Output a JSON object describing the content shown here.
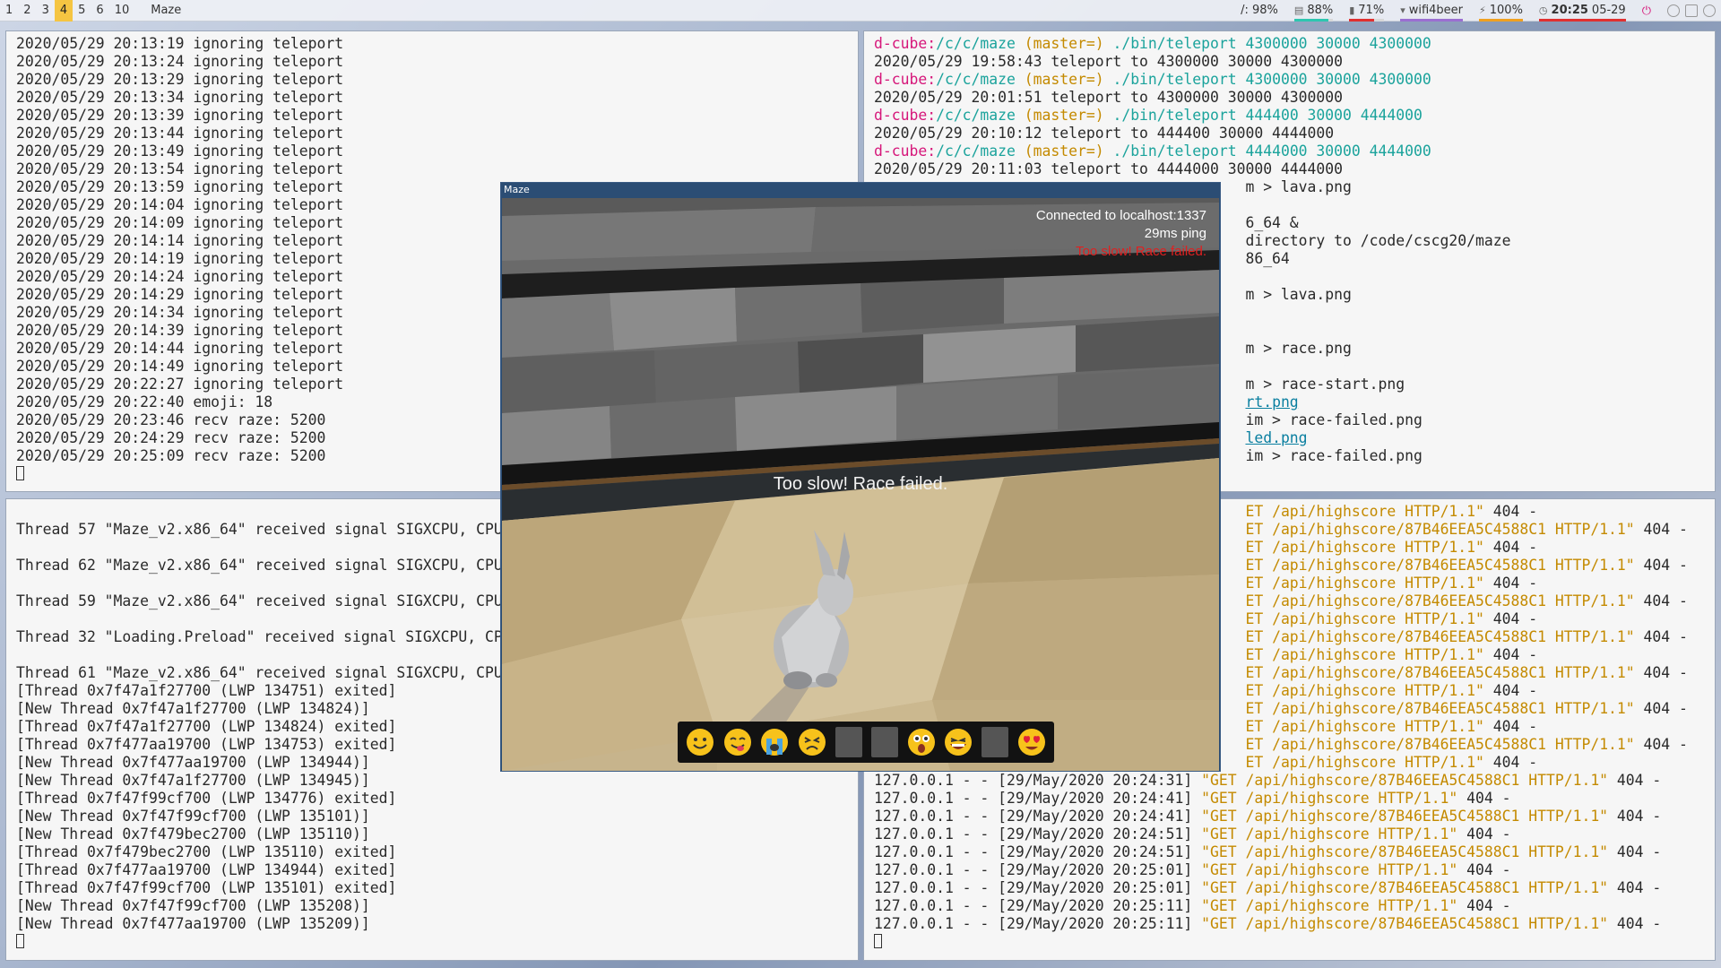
{
  "topbar": {
    "workspaces": [
      "1",
      "2",
      "3",
      "4",
      "5",
      "6",
      "10"
    ],
    "active_workspace": "4",
    "window_title": "Maze",
    "status": {
      "disk": "/: 98%",
      "mem": "88%",
      "cpu": "71%",
      "wifi": "wifi4beer",
      "battery": "100%",
      "time": "20:25",
      "date": "05-29"
    },
    "colors": {
      "mem": "#2ec6b0",
      "cpu": "#e03030",
      "wifi": "#9a6fd1",
      "battery": "#f0a020",
      "clock": "#e03030"
    }
  },
  "term_tl": {
    "lines": [
      "2020/05/29 20:13:19 ignoring teleport",
      "2020/05/29 20:13:24 ignoring teleport",
      "2020/05/29 20:13:29 ignoring teleport",
      "2020/05/29 20:13:34 ignoring teleport",
      "2020/05/29 20:13:39 ignoring teleport",
      "2020/05/29 20:13:44 ignoring teleport",
      "2020/05/29 20:13:49 ignoring teleport",
      "2020/05/29 20:13:54 ignoring teleport",
      "2020/05/29 20:13:59 ignoring teleport",
      "2020/05/29 20:14:04 ignoring teleport",
      "2020/05/29 20:14:09 ignoring teleport",
      "2020/05/29 20:14:14 ignoring teleport",
      "2020/05/29 20:14:19 ignoring teleport",
      "2020/05/29 20:14:24 ignoring teleport",
      "2020/05/29 20:14:29 ignoring teleport",
      "2020/05/29 20:14:34 ignoring teleport",
      "2020/05/29 20:14:39 ignoring teleport",
      "2020/05/29 20:14:44 ignoring teleport",
      "2020/05/29 20:14:49 ignoring teleport",
      "2020/05/29 20:22:27 ignoring teleport",
      "2020/05/29 20:22:40 emoji: 18",
      "2020/05/29 20:23:46 recv raze: 5200",
      "2020/05/29 20:24:29 recv raze: 5200",
      "2020/05/29 20:25:09 recv raze: 5200"
    ]
  },
  "term_tr": {
    "prompt_host": "d-cube:",
    "prompt_path": "/c/c/maze",
    "prompt_branch": "(master=)",
    "lines": [
      {
        "kind": "cmd",
        "cmd": "./bin/teleport 4300000 30000 4300000"
      },
      {
        "kind": "out",
        "text": "2020/05/29 19:58:43 teleport to 4300000 30000 4300000"
      },
      {
        "kind": "cmd",
        "cmd": "./bin/teleport 4300000 30000 4300000"
      },
      {
        "kind": "out",
        "text": "2020/05/29 20:01:51 teleport to 4300000 30000 4300000"
      },
      {
        "kind": "cmd",
        "cmd": "./bin/teleport 444400 30000 4444000"
      },
      {
        "kind": "out",
        "text": "2020/05/29 20:10:12 teleport to 444400 30000 4444000"
      },
      {
        "kind": "cmd",
        "cmd": "./bin/teleport 4444000 30000 4444000"
      },
      {
        "kind": "out",
        "text": "2020/05/29 20:11:03 teleport to 4444000 30000 4444000"
      },
      {
        "kind": "out",
        "text": "                                          m > lava.png"
      },
      {
        "kind": "blank"
      },
      {
        "kind": "out",
        "text": "                                          6_64 &"
      },
      {
        "kind": "out",
        "text": "                                          directory to /code/cscg20/maze"
      },
      {
        "kind": "out",
        "text": "                                          86_64"
      },
      {
        "kind": "blank"
      },
      {
        "kind": "out",
        "text": "                                          m > lava.png"
      },
      {
        "kind": "blank"
      },
      {
        "kind": "blank"
      },
      {
        "kind": "out",
        "text": "                                          m > race.png"
      },
      {
        "kind": "blank"
      },
      {
        "kind": "out",
        "text": "                                          m > race-start.png"
      },
      {
        "kind": "link",
        "pre": "                                          ",
        "text": "rt.png"
      },
      {
        "kind": "out",
        "text": "                                          im > race-failed.png"
      },
      {
        "kind": "link",
        "pre": "                                          ",
        "text": "led.png"
      },
      {
        "kind": "out",
        "text": "                                          im > race-failed.png"
      }
    ]
  },
  "term_bl": {
    "lines": [
      {
        "kind": "blank"
      },
      {
        "kind": "out",
        "text": "Thread 57 \"Maze_v2.x86_64\" received signal SIGXCPU, CPU"
      },
      {
        "kind": "blank"
      },
      {
        "kind": "out",
        "text": "Thread 62 \"Maze_v2.x86_64\" received signal SIGXCPU, CPU"
      },
      {
        "kind": "blank"
      },
      {
        "kind": "out",
        "text": "Thread 59 \"Maze_v2.x86_64\" received signal SIGXCPU, CPU"
      },
      {
        "kind": "blank"
      },
      {
        "kind": "out",
        "text": "Thread 32 \"Loading.Preload\" received signal SIGXCPU, CP"
      },
      {
        "kind": "blank"
      },
      {
        "kind": "out",
        "text": "Thread 61 \"Maze_v2.x86_64\" received signal SIGXCPU, CPU"
      },
      {
        "kind": "out",
        "text": "[Thread 0x7f47a1f27700 (LWP 134751) exited]"
      },
      {
        "kind": "out",
        "text": "[New Thread 0x7f47a1f27700 (LWP 134824)]"
      },
      {
        "kind": "out",
        "text": "[Thread 0x7f47a1f27700 (LWP 134824) exited]"
      },
      {
        "kind": "out",
        "text": "[Thread 0x7f477aa19700 (LWP 134753) exited]"
      },
      {
        "kind": "out",
        "text": "[New Thread 0x7f477aa19700 (LWP 134944)]"
      },
      {
        "kind": "out",
        "text": "[New Thread 0x7f47a1f27700 (LWP 134945)]"
      },
      {
        "kind": "out",
        "text": "[Thread 0x7f47f99cf700 (LWP 134776) exited]"
      },
      {
        "kind": "out",
        "text": "[New Thread 0x7f47f99cf700 (LWP 135101)]"
      },
      {
        "kind": "out",
        "text": "[New Thread 0x7f479bec2700 (LWP 135110)]"
      },
      {
        "kind": "out",
        "text": "[Thread 0x7f479bec2700 (LWP 135110) exited]"
      },
      {
        "kind": "out",
        "text": "[Thread 0x7f477aa19700 (LWP 134944) exited]"
      },
      {
        "kind": "out",
        "text": "[Thread 0x7f47f99cf700 (LWP 135101) exited]"
      },
      {
        "kind": "out",
        "text": "[New Thread 0x7f47f99cf700 (LWP 135208)]"
      },
      {
        "kind": "out",
        "text": "[New Thread 0x7f477aa19700 (LWP 135209)]"
      }
    ]
  },
  "term_br": {
    "lines": [
      {
        "pre": "                                          ",
        "get": "ET /api/highscore HTTP/1.1\"",
        "post": " 404 -"
      },
      {
        "pre": "                                          ",
        "get": "ET /api/highscore/87B46EEA5C4588C1 HTTP/1.1\"",
        "post": " 404 -"
      },
      {
        "pre": "                                          ",
        "get": "ET /api/highscore HTTP/1.1\"",
        "post": " 404 -"
      },
      {
        "pre": "                                          ",
        "get": "ET /api/highscore/87B46EEA5C4588C1 HTTP/1.1\"",
        "post": " 404 -"
      },
      {
        "pre": "                                          ",
        "get": "ET /api/highscore HTTP/1.1\"",
        "post": " 404 -"
      },
      {
        "pre": "                                          ",
        "get": "ET /api/highscore/87B46EEA5C4588C1 HTTP/1.1\"",
        "post": " 404 -"
      },
      {
        "pre": "                                          ",
        "get": "ET /api/highscore HTTP/1.1\"",
        "post": " 404 -"
      },
      {
        "pre": "                                          ",
        "get": "ET /api/highscore/87B46EEA5C4588C1 HTTP/1.1\"",
        "post": " 404 -"
      },
      {
        "pre": "                                          ",
        "get": "ET /api/highscore HTTP/1.1\"",
        "post": " 404 -"
      },
      {
        "pre": "                                          ",
        "get": "ET /api/highscore/87B46EEA5C4588C1 HTTP/1.1\"",
        "post": " 404 -"
      },
      {
        "pre": "                                          ",
        "get": "ET /api/highscore HTTP/1.1\"",
        "post": " 404 -"
      },
      {
        "pre": "                                          ",
        "get": "ET /api/highscore/87B46EEA5C4588C1 HTTP/1.1\"",
        "post": " 404 -"
      },
      {
        "pre": "                                          ",
        "get": "ET /api/highscore HTTP/1.1\"",
        "post": " 404 -"
      },
      {
        "pre": "                                          ",
        "get": "ET /api/highscore/87B46EEA5C4588C1 HTTP/1.1\"",
        "post": " 404 -"
      },
      {
        "pre": "                                          ",
        "get": "ET /api/highscore HTTP/1.1\"",
        "post": " 404 -"
      },
      {
        "pre": "127.0.0.1 - - [29/May/2020 20:24:31] ",
        "get": "\"GET /api/highscore/87B46EEA5C4588C1 HTTP/1.1\"",
        "post": " 404 -"
      },
      {
        "pre": "127.0.0.1 - - [29/May/2020 20:24:41] ",
        "get": "\"GET /api/highscore HTTP/1.1\"",
        "post": " 404 -"
      },
      {
        "pre": "127.0.0.1 - - [29/May/2020 20:24:41] ",
        "get": "\"GET /api/highscore/87B46EEA5C4588C1 HTTP/1.1\"",
        "post": " 404 -"
      },
      {
        "pre": "127.0.0.1 - - [29/May/2020 20:24:51] ",
        "get": "\"GET /api/highscore HTTP/1.1\"",
        "post": " 404 -"
      },
      {
        "pre": "127.0.0.1 - - [29/May/2020 20:24:51] ",
        "get": "\"GET /api/highscore/87B46EEA5C4588C1 HTTP/1.1\"",
        "post": " 404 -"
      },
      {
        "pre": "127.0.0.1 - - [29/May/2020 20:25:01] ",
        "get": "\"GET /api/highscore HTTP/1.1\"",
        "post": " 404 -"
      },
      {
        "pre": "127.0.0.1 - - [29/May/2020 20:25:01] ",
        "get": "\"GET /api/highscore/87B46EEA5C4588C1 HTTP/1.1\"",
        "post": " 404 -"
      },
      {
        "pre": "127.0.0.1 - - [29/May/2020 20:25:11] ",
        "get": "\"GET /api/highscore HTTP/1.1\"",
        "post": " 404 -"
      },
      {
        "pre": "127.0.0.1 - - [29/May/2020 20:25:11] ",
        "get": "\"GET /api/highscore/87B46EEA5C4588C1 HTTP/1.1\"",
        "post": " 404 -"
      }
    ]
  },
  "game": {
    "window_title": "Maze",
    "hud_connection": "Connected to localhost:1337",
    "hud_ping": "29ms ping",
    "hud_status": "Too slow! Race failed.",
    "center_message": "Too slow! Race failed.",
    "emoji_slots": [
      "smile",
      "yum",
      "crying",
      "persevere",
      "empty",
      "empty",
      "astonished",
      "laughing",
      "empty",
      "heart-eyes"
    ]
  }
}
